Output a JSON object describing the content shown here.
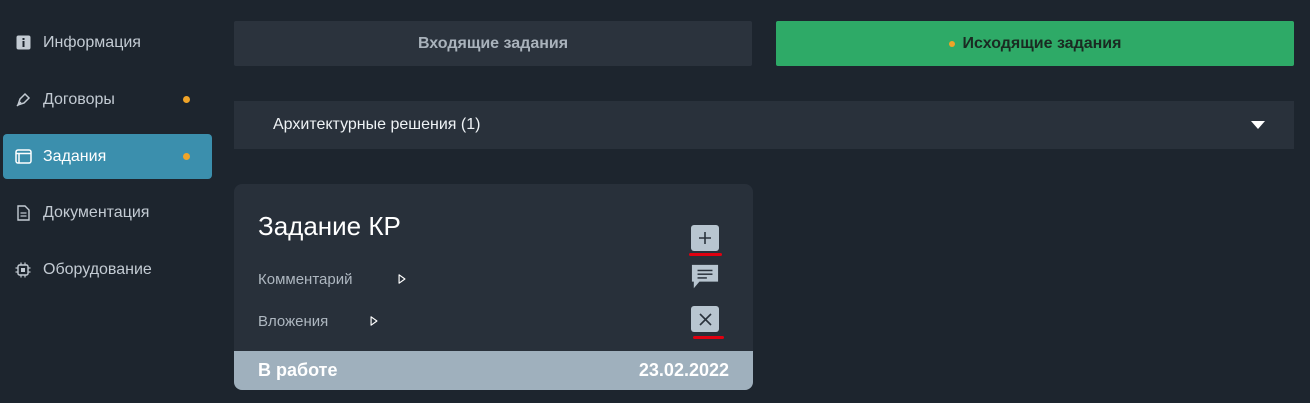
{
  "sidebar": {
    "items": [
      {
        "label": "Информация",
        "icon": "info-icon",
        "active": false,
        "dot": false
      },
      {
        "label": "Договоры",
        "icon": "pen-icon",
        "active": false,
        "dot": true
      },
      {
        "label": "Задания",
        "icon": "window-icon",
        "active": true,
        "dot": true
      },
      {
        "label": "Документация",
        "icon": "document-icon",
        "active": false,
        "dot": false
      },
      {
        "label": "Оборудование",
        "icon": "chip-icon",
        "active": false,
        "dot": false
      }
    ]
  },
  "tabs": {
    "incoming": "Входящие задания",
    "outgoing": "Исходящие задания"
  },
  "accordion": {
    "label": "Архитектурные решения (1)"
  },
  "card": {
    "title": "Задание КР",
    "comment_label": "Комментарий",
    "attachments_label": "Вложения",
    "status": "В работе",
    "date": "23.02.2022"
  },
  "colors": {
    "background": "#1d252e",
    "active_nav": "#3b8fad",
    "accent_green": "#2eaa67",
    "notification_dot": "#f0a428",
    "card_footer": "#9fb0bd",
    "annotation_red": "#e00010"
  }
}
